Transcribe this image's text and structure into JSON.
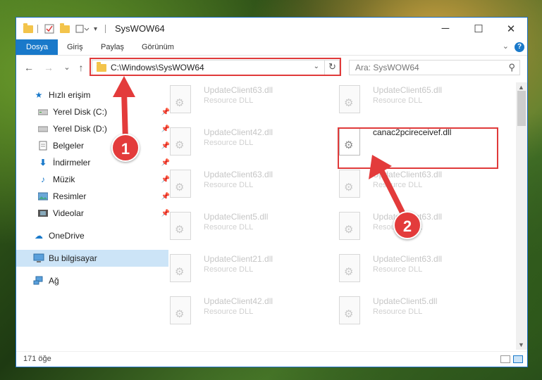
{
  "window": {
    "title": "SysWOW64",
    "minimize": "─",
    "maximize": "☐",
    "close": "✕"
  },
  "ribbon": {
    "tabs": [
      "Dosya",
      "Giriş",
      "Paylaş",
      "Görünüm"
    ],
    "help": "?"
  },
  "nav": {
    "back": "←",
    "forward": "→",
    "recent": "⌄",
    "up": "↑",
    "address": "C:\\Windows\\SysWOW64",
    "refresh": "↻",
    "search_placeholder": "Ara: SysWOW64"
  },
  "sidebar": {
    "items": [
      {
        "label": "Hızlı erişim",
        "icon": "star-icon"
      },
      {
        "label": "Yerel Disk (C:)",
        "icon": "drive-icon"
      },
      {
        "label": "Yerel Disk (D:)",
        "icon": "drive-icon"
      },
      {
        "label": "Belgeler",
        "icon": "documents-icon"
      },
      {
        "label": "İndirmeler",
        "icon": "download-icon"
      },
      {
        "label": "Müzik",
        "icon": "music-icon"
      },
      {
        "label": "Resimler",
        "icon": "pictures-icon"
      },
      {
        "label": "Videolar",
        "icon": "video-icon"
      },
      {
        "label": "OneDrive",
        "icon": "cloud-icon"
      },
      {
        "label": "Bu bilgisayar",
        "icon": "computer-icon"
      },
      {
        "label": "Ağ",
        "icon": "network-icon"
      }
    ]
  },
  "files": [
    {
      "name": "UpdateClient63.dll",
      "type": "Resource DLL"
    },
    {
      "name": "UpdateClient65.dll",
      "type": "Resource DLL"
    },
    {
      "name": "UpdateClient42.dll",
      "type": "Resource DLL"
    },
    {
      "name": "canac2pcireceivef.dll",
      "type": ""
    },
    {
      "name": "UpdateClient63.dll",
      "type": "Resource DLL"
    },
    {
      "name": "UpdateClient63.dll",
      "type": "Resource DLL"
    },
    {
      "name": "UpdateClient5.dll",
      "type": "Resource DLL"
    },
    {
      "name": "UpdateClient63.dll",
      "type": "Resource DLL"
    },
    {
      "name": "UpdateClient21.dll",
      "type": "Resource DLL"
    },
    {
      "name": "UpdateClient63.dll",
      "type": "Resource DLL"
    },
    {
      "name": "UpdateClient42.dll",
      "type": "Resource DLL"
    },
    {
      "name": "UpdateClient5.dll",
      "type": "Resource DLL"
    }
  ],
  "status": {
    "count": "171 öğe"
  },
  "annotations": {
    "badge1": "1",
    "badge2": "2",
    "color": "#e03a3a"
  }
}
